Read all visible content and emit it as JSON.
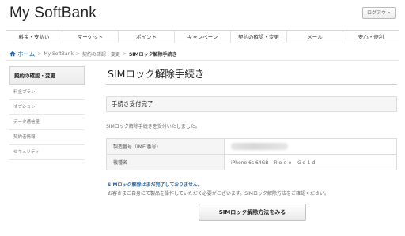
{
  "header": {
    "brand": "My SoftBank",
    "logout_label": "ログアウト"
  },
  "nav": {
    "items": [
      {
        "label": "料金・支払い"
      },
      {
        "label": "マーケット"
      },
      {
        "label": "ポイント"
      },
      {
        "label": "キャンペーン"
      },
      {
        "label": "契約の確認・変更"
      },
      {
        "label": "メール"
      },
      {
        "label": "安心・便利"
      }
    ]
  },
  "breadcrumb": {
    "home_icon": "home-icon",
    "home": "ホーム",
    "items": [
      "My SoftBank",
      "契約の確認・変更",
      "SIMロック解除手続き"
    ]
  },
  "sidebar": {
    "heading": "契約の確認・変更",
    "items": [
      {
        "label": "料金プラン"
      },
      {
        "label": "オプション"
      },
      {
        "label": "データ通信量"
      },
      {
        "label": "契約者情報"
      },
      {
        "label": "セキュリティ"
      }
    ]
  },
  "main": {
    "title": "SIMロック解除手続き",
    "section_heading": "手続き受付完了",
    "message": "SIMロック解除手続きを受付いたしました。",
    "table": {
      "rows": [
        {
          "label": "製造番号（IMEI番号）",
          "value": ""
        },
        {
          "label": "機種名",
          "value": "iPhone 6s 64GB　Ｒｏｓｅ　Ｇｏｌｄ"
        }
      ]
    },
    "notice_blue": "SIMロック解除はまだ完了しておりません。",
    "notice_gray": "お客さまご自身にて製品を操作していただく必要がございます。SIMロック解除方法をご確認ください。",
    "cta_label": "SIMロック解除方法をみる"
  },
  "colors": {
    "link_blue": "#1e69b3",
    "text": "#333333",
    "border": "#dddddd"
  }
}
